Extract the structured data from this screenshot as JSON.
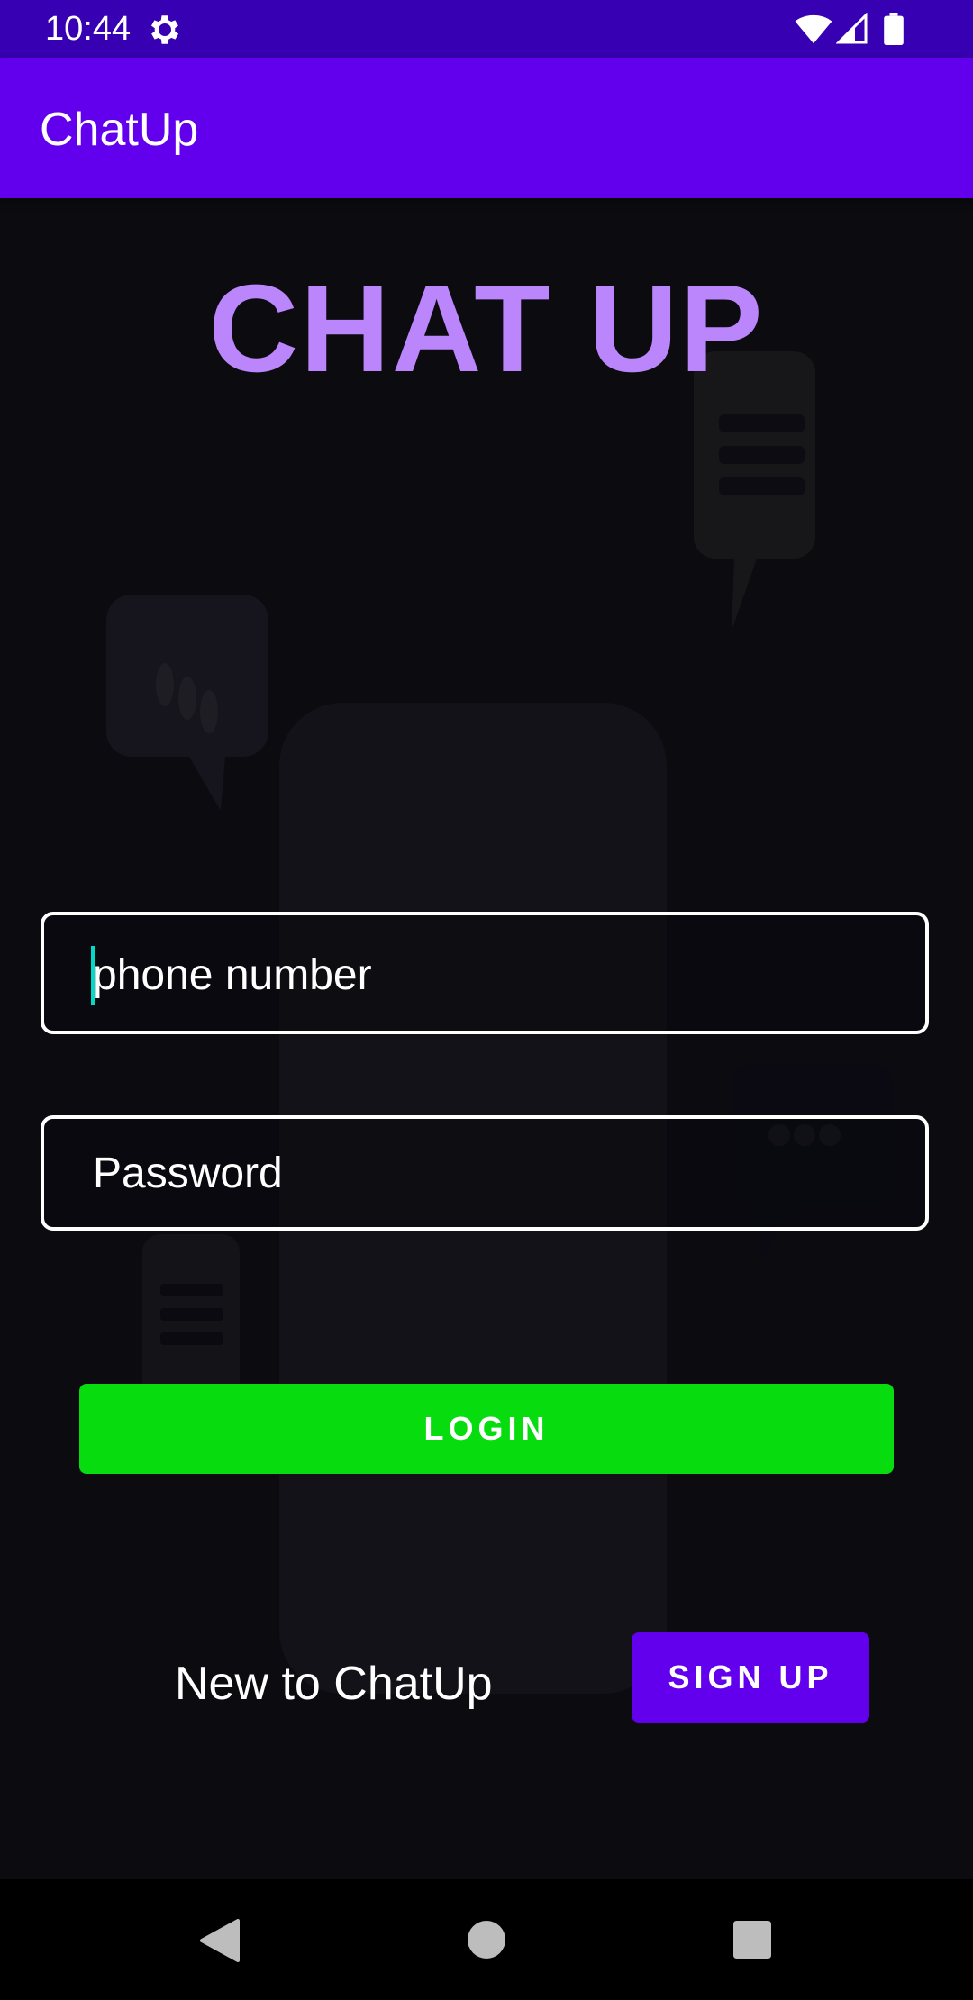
{
  "status_bar": {
    "time": "10:44",
    "icons": [
      "gear-icon",
      "wifi-icon",
      "signal-icon",
      "battery-icon"
    ]
  },
  "app_bar": {
    "title": "ChatUp"
  },
  "hero": {
    "title": "CHAT UP"
  },
  "form": {
    "phone_placeholder": "phone number",
    "password_placeholder": "Password",
    "login_label": "LOGIN"
  },
  "signup": {
    "prompt": "New to ChatUp",
    "button_label": "SIGN UP"
  },
  "nav": {
    "icons": [
      "back-icon",
      "home-icon",
      "recents-icon"
    ]
  },
  "colors": {
    "status_bar": "#3700b3",
    "app_bar": "#6200ee",
    "hero_title": "#bb86fc",
    "login_button": "#06dc0e",
    "signup_button": "#6200ee",
    "cursor": "#03dac5",
    "background": "#0c0b10"
  }
}
